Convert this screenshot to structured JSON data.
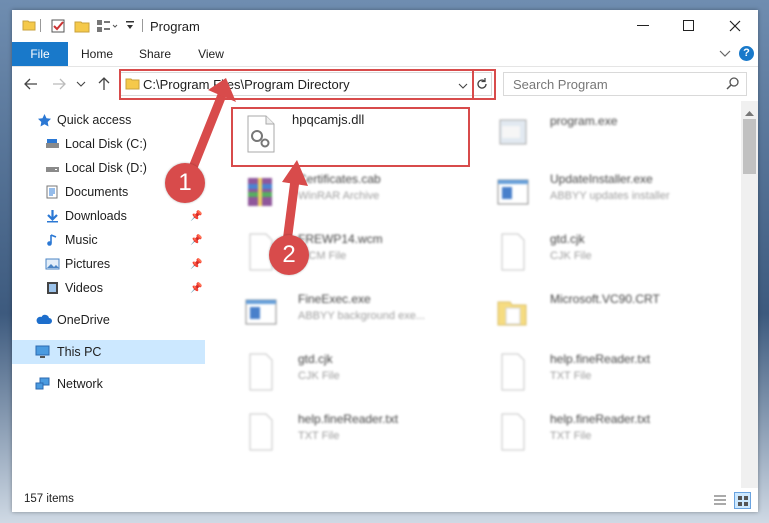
{
  "window": {
    "title": "Program"
  },
  "ribbon": {
    "tabs": [
      "File",
      "Home",
      "Share",
      "View"
    ]
  },
  "address": {
    "path": "C:\\Program Files\\Program Directory"
  },
  "search": {
    "placeholder": "Search Program"
  },
  "sidebar": {
    "items": [
      {
        "label": "Quick access",
        "icon": "star-icon"
      },
      {
        "label": "Local Disk (C:)",
        "icon": "drive-icon"
      },
      {
        "label": "Local Disk (D:)",
        "icon": "drive-icon"
      },
      {
        "label": "Documents",
        "icon": "documents-icon"
      },
      {
        "label": "Downloads",
        "icon": "download-icon"
      },
      {
        "label": "Music",
        "icon": "music-icon"
      },
      {
        "label": "Pictures",
        "icon": "pictures-icon"
      },
      {
        "label": "Videos",
        "icon": "videos-icon"
      },
      {
        "label": "OneDrive",
        "icon": "cloud-icon"
      },
      {
        "label": "This PC",
        "icon": "computer-icon"
      },
      {
        "label": "Network",
        "icon": "network-icon"
      }
    ]
  },
  "files": [
    {
      "name": "hpqcamjs.dll",
      "type": ""
    },
    {
      "name": "program.exe",
      "type": ""
    },
    {
      "name": "Certificates.cab",
      "type": "WinRAR Archive"
    },
    {
      "name": "UpdateInstaller.exe",
      "type": "ABBYY updates installer"
    },
    {
      "name": "FREWP14.wcm",
      "type": "WCM File"
    },
    {
      "name": "gtd.cjk",
      "type": "CJK File"
    },
    {
      "name": "FineExec.exe",
      "type": "ABBYY background exe..."
    },
    {
      "name": "Microsoft.VC90.CRT",
      "type": ""
    },
    {
      "name": "gtd.cjk",
      "type": "CJK File"
    },
    {
      "name": "help.fineReader.txt",
      "type": "TXT File"
    },
    {
      "name": "help.fineReader.txt",
      "type": "TXT File"
    },
    {
      "name": "help.fineReader.txt",
      "type": "TXT File"
    }
  ],
  "annotations": {
    "step1": "1",
    "step2": "2"
  },
  "status": {
    "count": "157 items"
  },
  "colors": {
    "accent": "#1979ca",
    "highlight": "#d84b4b",
    "selected_bg": "#cce8ff"
  }
}
